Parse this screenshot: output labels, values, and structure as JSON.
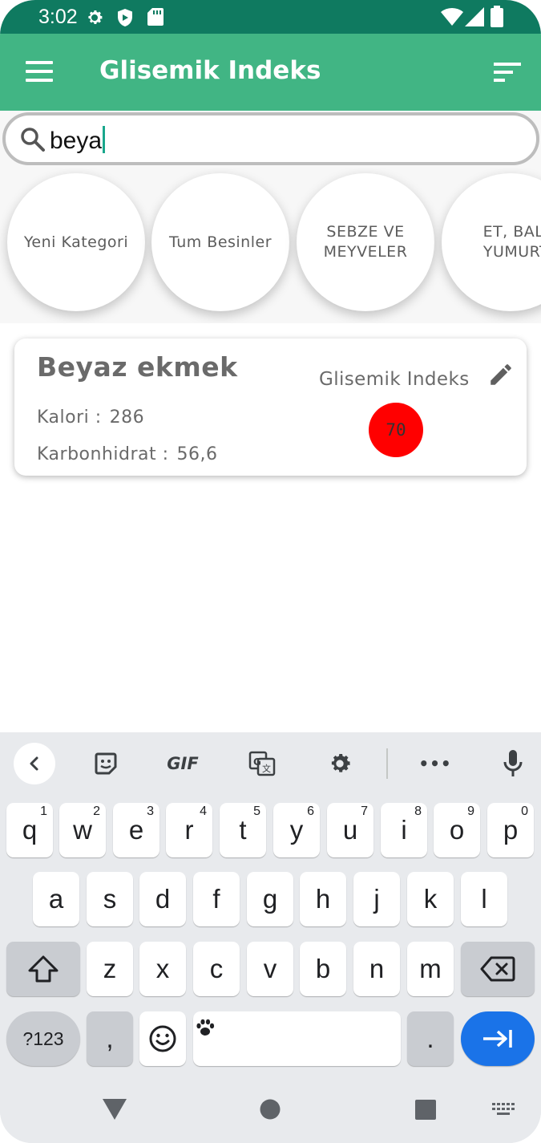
{
  "status_bar": {
    "time": "3:02",
    "left_icons": [
      "gear-icon",
      "shield-icon",
      "sd-card-icon"
    ],
    "right_icons": [
      "wifi-icon",
      "signal-icon",
      "battery-icon"
    ]
  },
  "app_bar": {
    "title": "Glisemik Indeks",
    "menu_icon": "hamburger-menu-icon",
    "sort_icon": "sort-icon",
    "background": "#41b584"
  },
  "search": {
    "query": "beya",
    "icon": "search-icon"
  },
  "categories": [
    {
      "label": "Yeni Kategori"
    },
    {
      "label": "Tum Besinler"
    },
    {
      "label": "SEBZE VE\nMEYVELER"
    },
    {
      "label": "ET, BALIK\nYUMURTA"
    }
  ],
  "results": [
    {
      "name": "Beyaz ekmek",
      "calorie_label": "Kalori :",
      "calorie_value": "286",
      "carb_label": "Karbonhidrat :",
      "carb_value": "56,6",
      "gi_label": "Glisemik Indeks",
      "gi_value": "70",
      "gi_color": "#ff0000"
    }
  ],
  "keyboard": {
    "toolbar": [
      "back-icon",
      "sticker-icon",
      "GIF",
      "translate-icon",
      "gear-icon",
      "more-icon",
      "mic-icon"
    ],
    "gif_label": "GIF",
    "more_label": "•••",
    "row1": [
      {
        "k": "q",
        "h": "1"
      },
      {
        "k": "w",
        "h": "2"
      },
      {
        "k": "e",
        "h": "3"
      },
      {
        "k": "r",
        "h": "4"
      },
      {
        "k": "t",
        "h": "5"
      },
      {
        "k": "y",
        "h": "6"
      },
      {
        "k": "u",
        "h": "7"
      },
      {
        "k": "i",
        "h": "8"
      },
      {
        "k": "o",
        "h": "9"
      },
      {
        "k": "p",
        "h": "0"
      }
    ],
    "row2": [
      "a",
      "s",
      "d",
      "f",
      "g",
      "h",
      "j",
      "k",
      "l"
    ],
    "row3": [
      "z",
      "x",
      "c",
      "v",
      "b",
      "n",
      "m"
    ],
    "sym_label": "?123",
    "comma_label": ",",
    "period_label": ".",
    "accent": "#1a73e8"
  },
  "nav_bar": [
    "back-triangle-icon",
    "home-circle-icon",
    "recents-square-icon",
    "keyboard-switch-icon"
  ]
}
